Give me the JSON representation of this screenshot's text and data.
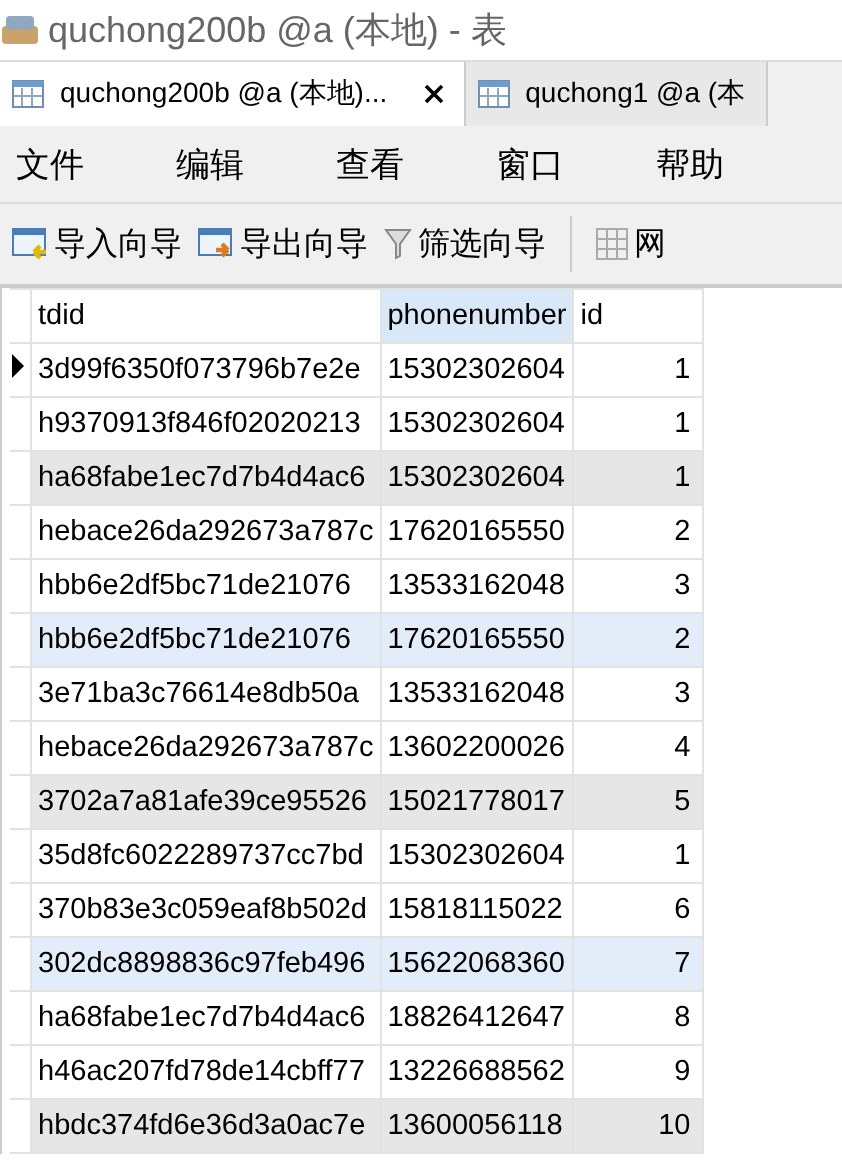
{
  "window": {
    "title": "quchong200b @a (本地) - 表"
  },
  "tabs": [
    {
      "label": "quchong200b @a (本地)...",
      "selected": true,
      "closable": true
    },
    {
      "label": "quchong1 @a (本",
      "selected": false,
      "closable": false
    }
  ],
  "menu": [
    "文件",
    "编辑",
    "查看",
    "窗口",
    "帮助"
  ],
  "toolbar": [
    {
      "kind": "import",
      "label": "导入向导"
    },
    {
      "kind": "export",
      "label": "导出向导"
    },
    {
      "kind": "filter",
      "label": "筛选向导"
    },
    {
      "kind": "grid",
      "label": "网"
    }
  ],
  "table": {
    "columns": [
      {
        "label": "tdid",
        "selected": false
      },
      {
        "label": "phonenumber",
        "selected": true
      },
      {
        "label": "id",
        "selected": false
      }
    ],
    "rows": [
      {
        "cells": [
          "3d99f6350f073796b7e2e",
          "15302302604",
          "1"
        ],
        "current": true,
        "dimmed": false,
        "selected": false
      },
      {
        "cells": [
          "h9370913f846f02020213",
          "15302302604",
          "1"
        ],
        "current": false,
        "dimmed": false,
        "selected": false
      },
      {
        "cells": [
          "ha68fabe1ec7d7b4d4ac6",
          "15302302604",
          "1"
        ],
        "current": false,
        "dimmed": true,
        "selected": false
      },
      {
        "cells": [
          "hebace26da292673a787c",
          "17620165550",
          "2"
        ],
        "current": false,
        "dimmed": false,
        "selected": false
      },
      {
        "cells": [
          "hbb6e2df5bc71de21076",
          "13533162048",
          "3"
        ],
        "current": false,
        "dimmed": false,
        "selected": false
      },
      {
        "cells": [
          "hbb6e2df5bc71de21076",
          "17620165550",
          "2"
        ],
        "current": false,
        "dimmed": false,
        "selected": true
      },
      {
        "cells": [
          "3e71ba3c76614e8db50a",
          "13533162048",
          "3"
        ],
        "current": false,
        "dimmed": false,
        "selected": false
      },
      {
        "cells": [
          "hebace26da292673a787c",
          "13602200026",
          "4"
        ],
        "current": false,
        "dimmed": false,
        "selected": false
      },
      {
        "cells": [
          "3702a7a81afe39ce95526",
          "15021778017",
          "5"
        ],
        "current": false,
        "dimmed": true,
        "selected": false
      },
      {
        "cells": [
          "35d8fc6022289737cc7bd",
          "15302302604",
          "1"
        ],
        "current": false,
        "dimmed": false,
        "selected": false
      },
      {
        "cells": [
          "370b83e3c059eaf8b502d",
          "15818115022",
          "6"
        ],
        "current": false,
        "dimmed": false,
        "selected": false
      },
      {
        "cells": [
          "302dc8898836c97feb496",
          "15622068360",
          "7"
        ],
        "current": false,
        "dimmed": false,
        "selected": true
      },
      {
        "cells": [
          "ha68fabe1ec7d7b4d4ac6",
          "18826412647",
          "8"
        ],
        "current": false,
        "dimmed": false,
        "selected": false
      },
      {
        "cells": [
          "h46ac207fd78de14cbff77",
          "13226688562",
          "9"
        ],
        "current": false,
        "dimmed": false,
        "selected": false
      },
      {
        "cells": [
          "hbdc374fd6e36d3a0ac7e",
          "13600056118",
          "10"
        ],
        "current": false,
        "dimmed": true,
        "selected": false
      }
    ]
  }
}
